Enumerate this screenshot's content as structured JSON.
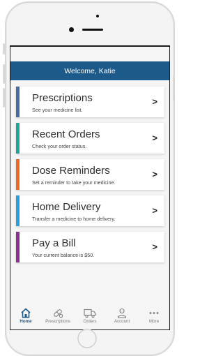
{
  "header": {
    "welcome_text": "Welcome, Katie"
  },
  "cards": [
    {
      "title": "Prescriptions",
      "subtitle": "See your medicine list.",
      "accent": "#4a6aa5"
    },
    {
      "title": "Recent Orders",
      "subtitle": "Check your order status.",
      "accent": "#1fa49a"
    },
    {
      "title": "Dose Reminders",
      "subtitle": "Set a reminder to take your medicine.",
      "accent": "#ef6a1e"
    },
    {
      "title": "Home Delivery",
      "subtitle": "Transfer a medicine to home delivery.",
      "accent": "#2b9fd8"
    },
    {
      "title": "Pay a Bill",
      "subtitle": "Your current balance is $50.",
      "accent": "#8d2e93"
    }
  ],
  "chevron": ">",
  "tabs": [
    {
      "label": "Home",
      "icon": "home-icon",
      "active": true
    },
    {
      "label": "Prescriptions",
      "icon": "pill-icon",
      "active": false
    },
    {
      "label": "Orders",
      "icon": "truck-icon",
      "active": false
    },
    {
      "label": "Account",
      "icon": "person-icon",
      "active": false
    },
    {
      "label": "More",
      "icon": "ellipsis-icon",
      "active": false
    }
  ],
  "colors": {
    "brand": "#1d5a8c",
    "inactive": "#7a7a7a"
  }
}
